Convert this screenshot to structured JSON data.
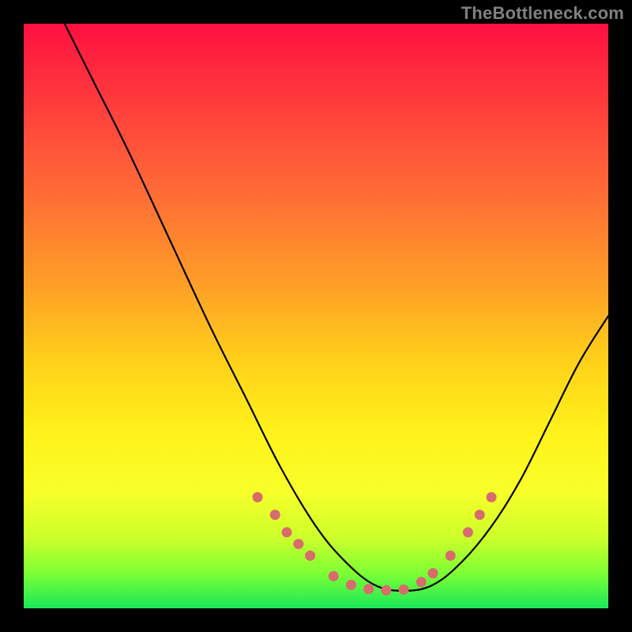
{
  "watermark": "TheBottleneck.com",
  "chart_data": {
    "type": "line",
    "title": "",
    "xlabel": "",
    "ylabel": "",
    "xlim": [
      0,
      100
    ],
    "ylim": [
      0,
      100
    ],
    "series": [
      {
        "name": "curve",
        "x": [
          7,
          12,
          18,
          25,
          32,
          38,
          44,
          50,
          55,
          60,
          65,
          70,
          75,
          80,
          85,
          90,
          95,
          100
        ],
        "y": [
          100,
          90,
          78,
          63,
          48,
          36,
          24,
          14,
          8,
          4,
          3,
          4,
          8,
          14,
          22,
          32,
          42,
          50
        ]
      },
      {
        "name": "markers",
        "type": "scatter",
        "points": [
          {
            "x": 40,
            "y": 19
          },
          {
            "x": 43,
            "y": 16
          },
          {
            "x": 45,
            "y": 13
          },
          {
            "x": 47,
            "y": 11
          },
          {
            "x": 49,
            "y": 9
          },
          {
            "x": 53,
            "y": 5.5
          },
          {
            "x": 56,
            "y": 4
          },
          {
            "x": 59,
            "y": 3.3
          },
          {
            "x": 62,
            "y": 3.1
          },
          {
            "x": 65,
            "y": 3.2
          },
          {
            "x": 68,
            "y": 4.5
          },
          {
            "x": 70,
            "y": 6
          },
          {
            "x": 73,
            "y": 9
          },
          {
            "x": 76,
            "y": 13
          },
          {
            "x": 78,
            "y": 16
          },
          {
            "x": 80,
            "y": 19
          }
        ]
      }
    ]
  }
}
